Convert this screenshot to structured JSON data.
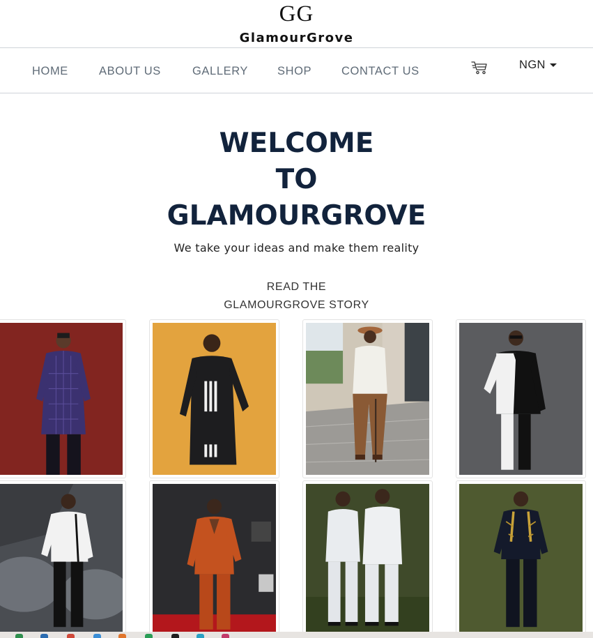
{
  "brand": {
    "mark": "GG",
    "name": "GlamourGrove"
  },
  "nav": {
    "items": [
      {
        "label": "HOME"
      },
      {
        "label": "ABOUT US"
      },
      {
        "label": "GALLERY"
      },
      {
        "label": "SHOP"
      },
      {
        "label": "CONTACT US"
      }
    ],
    "cart_icon": "cart-icon",
    "currency": "NGN"
  },
  "hero": {
    "title_lines": [
      "WELCOME",
      "TO",
      "GLAMOURGROVE"
    ],
    "tagline": "We take your ideas and make them reality",
    "story_lines": [
      "READ THE",
      "GLAMOURGROVE STORY"
    ]
  },
  "gallery": {
    "items": [
      {
        "subject": "man in purple plaid native attire",
        "background": "#8e2a24",
        "outfit": "#3b3170"
      },
      {
        "subject": "man in black kaftan with white stripes",
        "background": "#e3a33e",
        "outfit": "#1d1d1f"
      },
      {
        "subject": "man in white double-breasted jacket and hat",
        "background": "#cfc7b8",
        "outfit": "#f1f0ea"
      },
      {
        "subject": "man in black and white tuxedo",
        "background": "#5b5c5f",
        "outfit": "#111111"
      },
      {
        "subject": "man in white jacket with smoke",
        "background": "#4a4d52",
        "outfit": "#f2f2f2"
      },
      {
        "subject": "man in orange suit on red carpet",
        "background": "#2b2b2e",
        "outfit": "#c4521f"
      },
      {
        "subject": "two men in white suits",
        "background": "#3f4a2a",
        "outfit": "#e9ecef"
      },
      {
        "subject": "man in embroidered black suit",
        "background": "#4f5a30",
        "outfit": "#141a2b"
      }
    ]
  },
  "colors": {
    "heading": "#12233c",
    "nav_text": "#5f6b77",
    "divider": "#cfd3d8"
  }
}
